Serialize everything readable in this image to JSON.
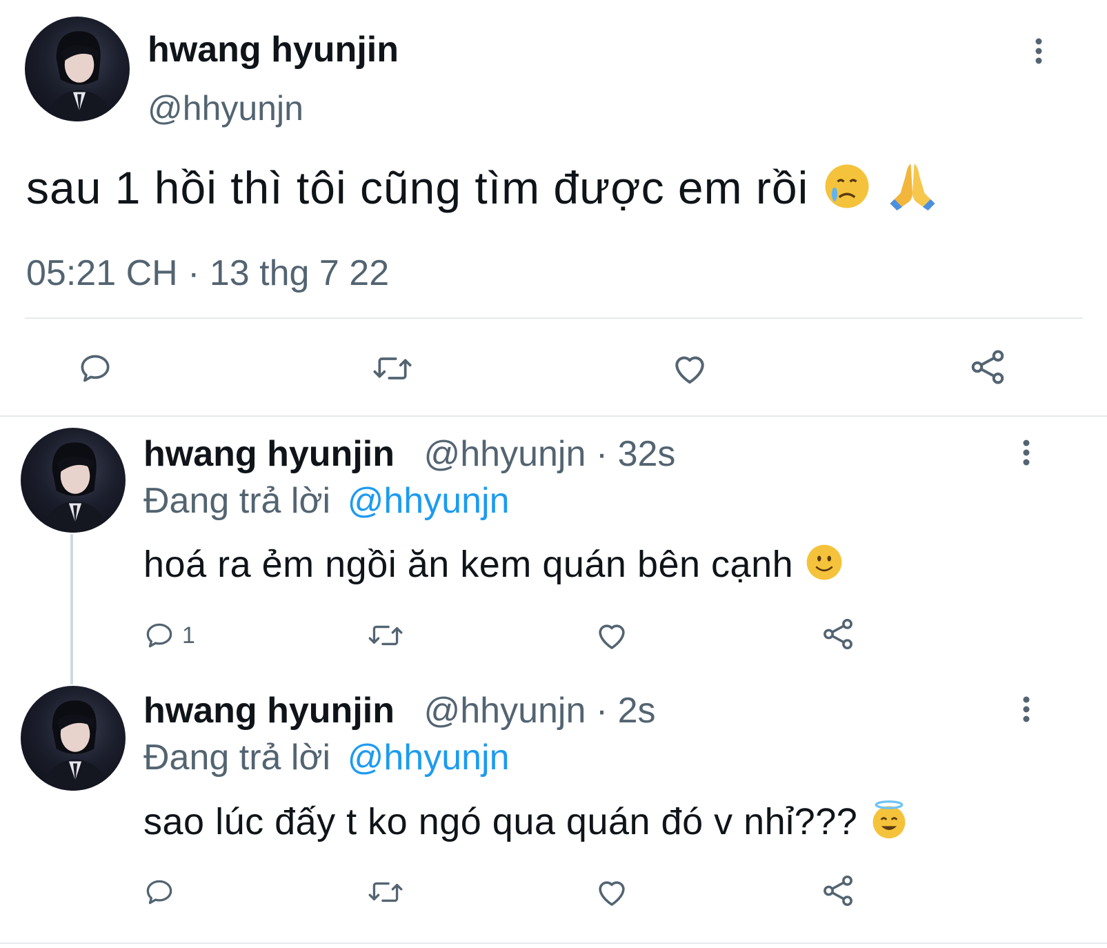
{
  "main_tweet": {
    "display_name": "hwang hyunjin",
    "handle": "@hhyunjn",
    "text": "sau 1 hồi thì tôi cũng tìm được em rồi",
    "emojis": [
      "crying-face-emoji",
      "folded-hands-emoji"
    ],
    "timestamp": "05:21 CH · 13 thg 7 22",
    "actions": [
      "reply-icon",
      "retweet-icon",
      "like-icon",
      "share-icon"
    ]
  },
  "replies": [
    {
      "display_name": "hwang hyunjin",
      "handle_time": "@hhyunjn · 32s",
      "replying_prefix": "Đang trả lời",
      "replying_to": "@hhyunjn",
      "text": "hoá ra ẻm ngồi ăn kem quán bên cạnh",
      "emoji": "slightly-smiling-face-emoji",
      "reply_count": "1"
    },
    {
      "display_name": "hwang hyunjin",
      "handle_time": "@hhyunjn · 2s",
      "replying_prefix": "Đang trả lời",
      "replying_to": "@hhyunjn",
      "text": "sao lúc đấy t ko ngó qua quán đó v nhỉ???",
      "emoji": "smiling-face-with-halo-emoji",
      "reply_count": ""
    }
  ],
  "colors": {
    "text": "#0f1419",
    "secondary": "#536471",
    "link": "#1d9bf0",
    "divider": "#e6e9ec"
  }
}
